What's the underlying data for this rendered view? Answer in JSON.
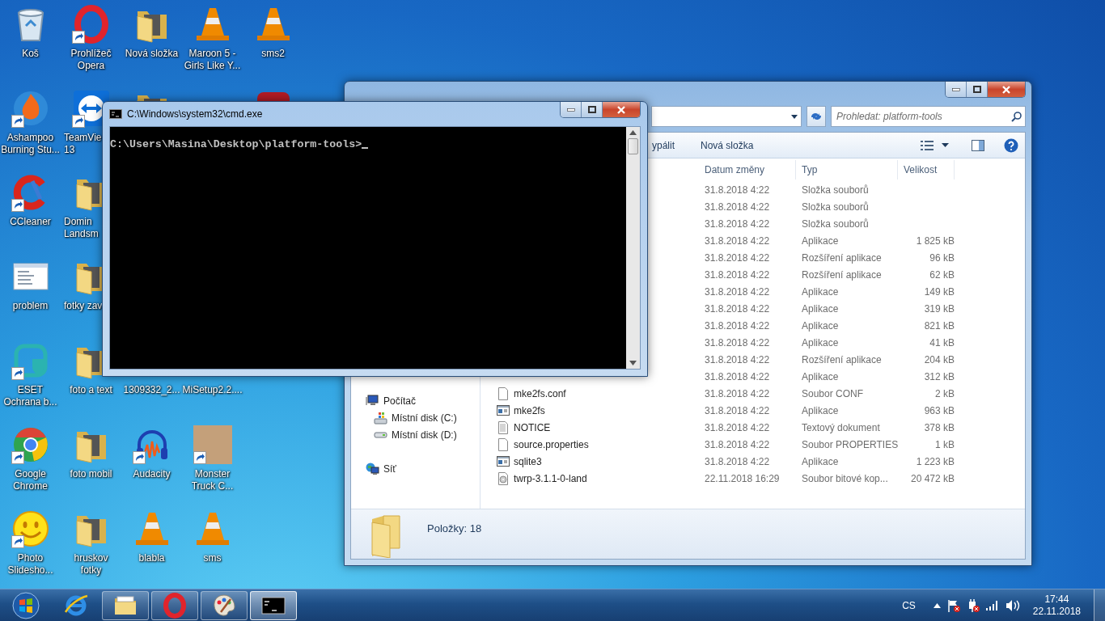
{
  "desktop": {
    "columns": [
      [
        {
          "kind": "recycle-bin",
          "label": "Koš",
          "shortcut": false,
          "cut": false
        },
        {
          "kind": "flame",
          "label": "Ashampoo\nBurning Stu...",
          "shortcut": true,
          "cut": false
        },
        {
          "kind": "letter-c",
          "label": "CCleaner",
          "shortcut": true,
          "cut": false
        },
        {
          "kind": "screenshot",
          "label": "problem",
          "shortcut": false,
          "cut": false
        },
        {
          "kind": "shield",
          "label": "ESET\nOchrana b...",
          "shortcut": true,
          "cut": false
        },
        {
          "kind": "chrome",
          "label": "Google\nChrome",
          "shortcut": true,
          "cut": false
        },
        {
          "kind": "smiley",
          "label": "Photo\nSlidesho...",
          "shortcut": true,
          "cut": false
        }
      ],
      [
        {
          "kind": "ring",
          "label": "Prohlížeč\nOpera",
          "shortcut": true,
          "cut": false
        },
        {
          "kind": "arrows",
          "label": "TeamVie\n13",
          "shortcut": true,
          "cut": true
        },
        {
          "kind": "folder",
          "label": "Domin\nLandsm",
          "shortcut": false,
          "cut": true
        },
        {
          "kind": "folder",
          "label": "fotky zav",
          "shortcut": false,
          "cut": true
        },
        {
          "kind": "folder",
          "label": "foto a text",
          "shortcut": false,
          "cut": false
        },
        {
          "kind": "folder",
          "label": "foto mobil",
          "shortcut": false,
          "cut": false
        },
        {
          "kind": "folder",
          "label": "hruskov\nfotky",
          "shortcut": false,
          "cut": false
        }
      ],
      [
        {
          "kind": "folder",
          "label": "Nová složka",
          "shortcut": false,
          "cut": false
        },
        {
          "kind": "folder",
          "shortcut": false
        },
        null,
        null,
        {
          "label": "1309332_2...",
          "shortcut": false,
          "cut": false
        },
        {
          "kind": "headphones",
          "label": "Audacity",
          "shortcut": true,
          "cut": false
        },
        {
          "kind": "cone",
          "label": "blabla",
          "shortcut": false,
          "cut": false
        }
      ],
      [
        {
          "kind": "cone",
          "label": "Maroon 5 -\nGirls Like Y...",
          "shortcut": false,
          "cut": false
        },
        null,
        null,
        null,
        {
          "label": "MiSetup2.2....",
          "shortcut": false,
          "cut": false
        },
        {
          "kind": "photo",
          "label": "Monster\nTruck C...",
          "shortcut": true,
          "cut": false
        },
        {
          "kind": "cone",
          "label": "sms",
          "shortcut": false,
          "cut": false
        }
      ],
      [
        {
          "kind": "cone",
          "label": "sms2",
          "shortcut": false,
          "cut": false
        },
        {
          "kind": "red-app",
          "shortcut": false
        }
      ]
    ]
  },
  "explorer": {
    "search": {
      "placeholder": "Prohledat: platform-tools"
    },
    "toolbar": [
      {
        "label": "ypálit"
      },
      {
        "label": "Nová složka"
      }
    ],
    "columns": [
      "Datum změny",
      "Typ",
      "Velikost"
    ],
    "nav": [
      {
        "kind": "computer",
        "label": "Počítač",
        "children": [
          {
            "kind": "drive-windows",
            "label": "Místní disk (C:)"
          },
          {
            "kind": "drive",
            "label": "Místní disk (D:)"
          }
        ]
      },
      {
        "kind": "network",
        "label": "Síť"
      }
    ],
    "rows": [
      {
        "date": "31.8.2018 4:22",
        "type": "Složka souborů"
      },
      {
        "date": "31.8.2018 4:22",
        "type": "Složka souborů"
      },
      {
        "date": "31.8.2018 4:22",
        "type": "Složka souborů"
      },
      {
        "date": "31.8.2018 4:22",
        "type": "Aplikace",
        "size": "1 825 kB"
      },
      {
        "date": "31.8.2018 4:22",
        "type": "Rozšíření aplikace",
        "size": "96 kB"
      },
      {
        "date": "31.8.2018 4:22",
        "type": "Rozšíření aplikace",
        "size": "62 kB"
      },
      {
        "date": "31.8.2018 4:22",
        "type": "Aplikace",
        "size": "149 kB"
      },
      {
        "date": "31.8.2018 4:22",
        "type": "Aplikace",
        "size": "319 kB"
      },
      {
        "date": "31.8.2018 4:22",
        "type": "Aplikace",
        "size": "821 kB"
      },
      {
        "date": "31.8.2018 4:22",
        "type": "Aplikace",
        "size": "41 kB"
      },
      {
        "date": "31.8.2018 4:22",
        "type": "Rozšíření aplikace",
        "size": "204 kB"
      },
      {
        "date": "31.8.2018 4:22",
        "type": "Aplikace",
        "size": "312 kB"
      },
      {
        "kind": "file",
        "name": "mke2fs.conf",
        "date": "31.8.2018 4:22",
        "type": "Soubor CONF",
        "size": "2 kB"
      },
      {
        "kind": "app",
        "name": "mke2fs",
        "date": "31.8.2018 4:22",
        "type": "Aplikace",
        "size": "963 kB"
      },
      {
        "kind": "text",
        "name": "NOTICE",
        "date": "31.8.2018 4:22",
        "type": "Textový dokument",
        "size": "378 kB"
      },
      {
        "kind": "file",
        "name": "source.properties",
        "date": "31.8.2018 4:22",
        "type": "Soubor PROPERTIES",
        "size": "1 kB"
      },
      {
        "kind": "app",
        "name": "sqlite3",
        "date": "31.8.2018 4:22",
        "type": "Aplikace",
        "size": "1 223 kB"
      },
      {
        "kind": "disk-image",
        "name": "twrp-3.1.1-0-land",
        "date": "22.11.2018 16:29",
        "type": "Soubor bitové kop...",
        "size": "20 472 kB"
      }
    ],
    "status": "Položky: 18"
  },
  "cmd": {
    "title": "C:\\Windows\\system32\\cmd.exe",
    "prompt": "C:\\Users\\Masina\\Desktop\\platform-tools>"
  },
  "taskbar": {
    "apps": [
      {
        "kind": "browser-e",
        "running": false,
        "active": false
      },
      {
        "kind": "folder",
        "running": true,
        "active": false
      },
      {
        "kind": "ring",
        "running": true,
        "active": false
      },
      {
        "kind": "palette",
        "running": true,
        "active": false
      },
      {
        "kind": "console",
        "running": true,
        "active": true
      }
    ],
    "language": "CS",
    "time": "17:44",
    "date": "22.11.2018"
  }
}
